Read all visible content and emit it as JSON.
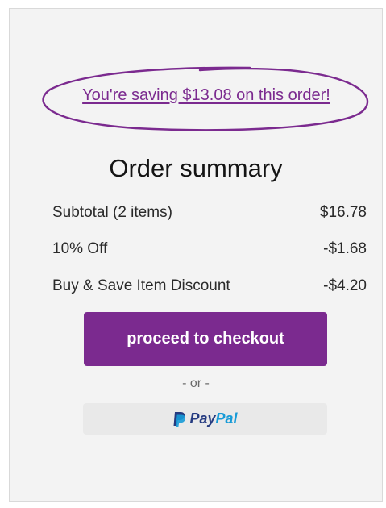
{
  "savings": {
    "text": "You're saving $13.08 on this order!",
    "accent_color": "#7b2a8f"
  },
  "summary": {
    "title": "Order summary",
    "lines": [
      {
        "label": "Subtotal (2 items)",
        "value": "$16.78"
      },
      {
        "label": "10% Off",
        "value": "-$1.68"
      },
      {
        "label": "Buy & Save Item Discount",
        "value": "-$4.20"
      }
    ]
  },
  "checkout": {
    "label": "proceed to checkout",
    "color": "#7b2a8f"
  },
  "separator": "- or -",
  "paypal": {
    "icon": "paypal-icon",
    "word_pay": "Pay",
    "word_pal": "Pal",
    "pay_color": "#253b80",
    "pal_color": "#179bd7"
  }
}
